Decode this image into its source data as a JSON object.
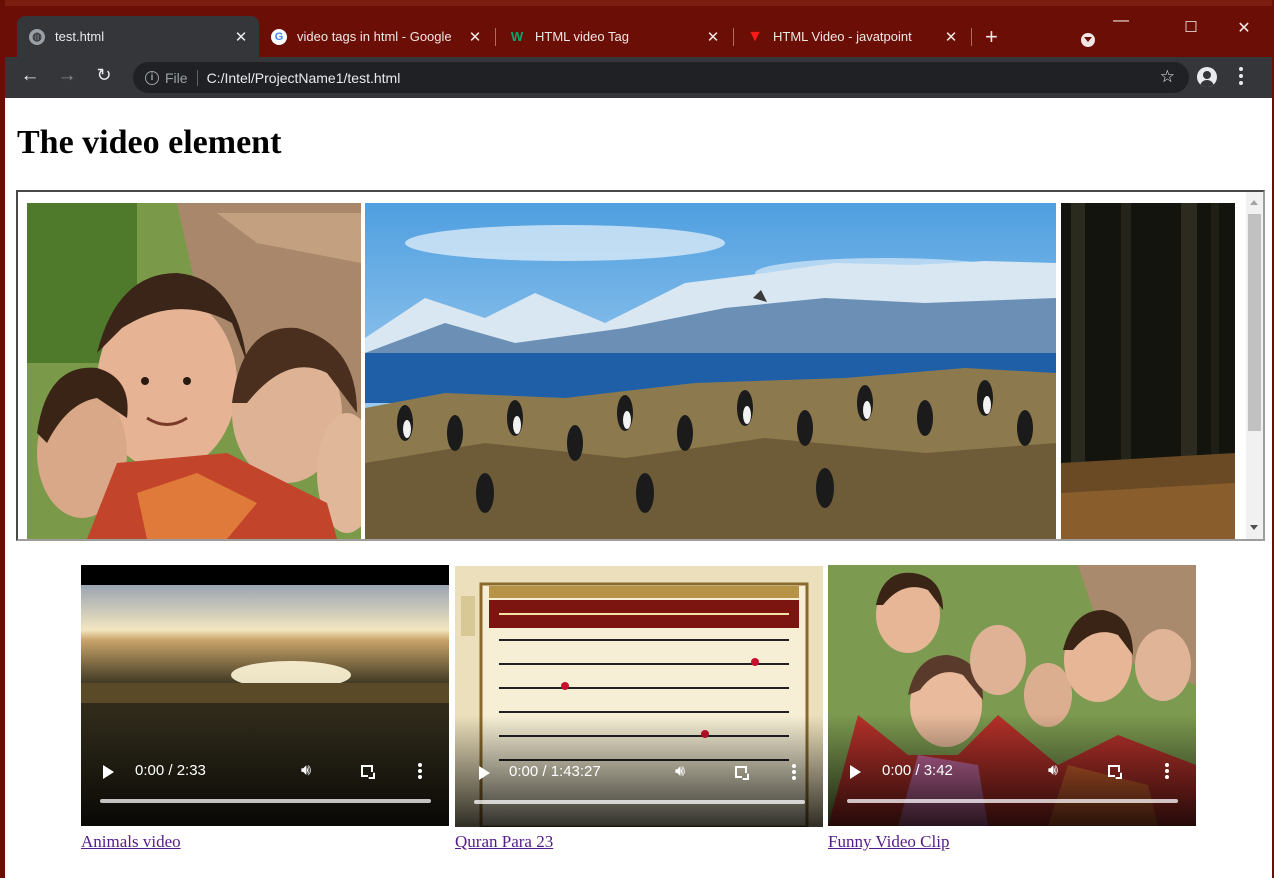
{
  "browser": {
    "tabs": [
      {
        "title": "test.html",
        "icon": "globe-icon",
        "active": true
      },
      {
        "title": "video tags in html - Google",
        "icon": "google-icon",
        "active": false
      },
      {
        "title": "HTML video Tag",
        "icon": "w3schools-icon",
        "active": false
      },
      {
        "title": "HTML Video - javatpoint",
        "icon": "javatpoint-icon",
        "active": false
      }
    ],
    "new_tab": "+",
    "close": "✕",
    "address": {
      "scheme_label": "File",
      "url": "C:/Intel/ProjectName1/test.html"
    },
    "colors": {
      "frame": "#6b0f06",
      "toolbar": "#35363a",
      "omnibox": "#202124"
    }
  },
  "page": {
    "heading": "The video element",
    "iframe": {
      "images": [
        {
          "subject": "children",
          "icon": "photo-children"
        },
        {
          "subject": "mountain-birds",
          "icon": "photo-landscape"
        },
        {
          "subject": "forest",
          "icon": "photo-forest"
        }
      ]
    },
    "videos": [
      {
        "time": "0:00 / 2:33",
        "link": "Animals video",
        "poster": "sunset-landscape"
      },
      {
        "time": "0:00 / 1:43:27",
        "link": "Quran Para 23",
        "poster": "quran-page"
      },
      {
        "time": "0:00 / 3:42",
        "link": "Funny Video Clip",
        "poster": "children-group"
      }
    ],
    "link_color": "#551a8b"
  }
}
